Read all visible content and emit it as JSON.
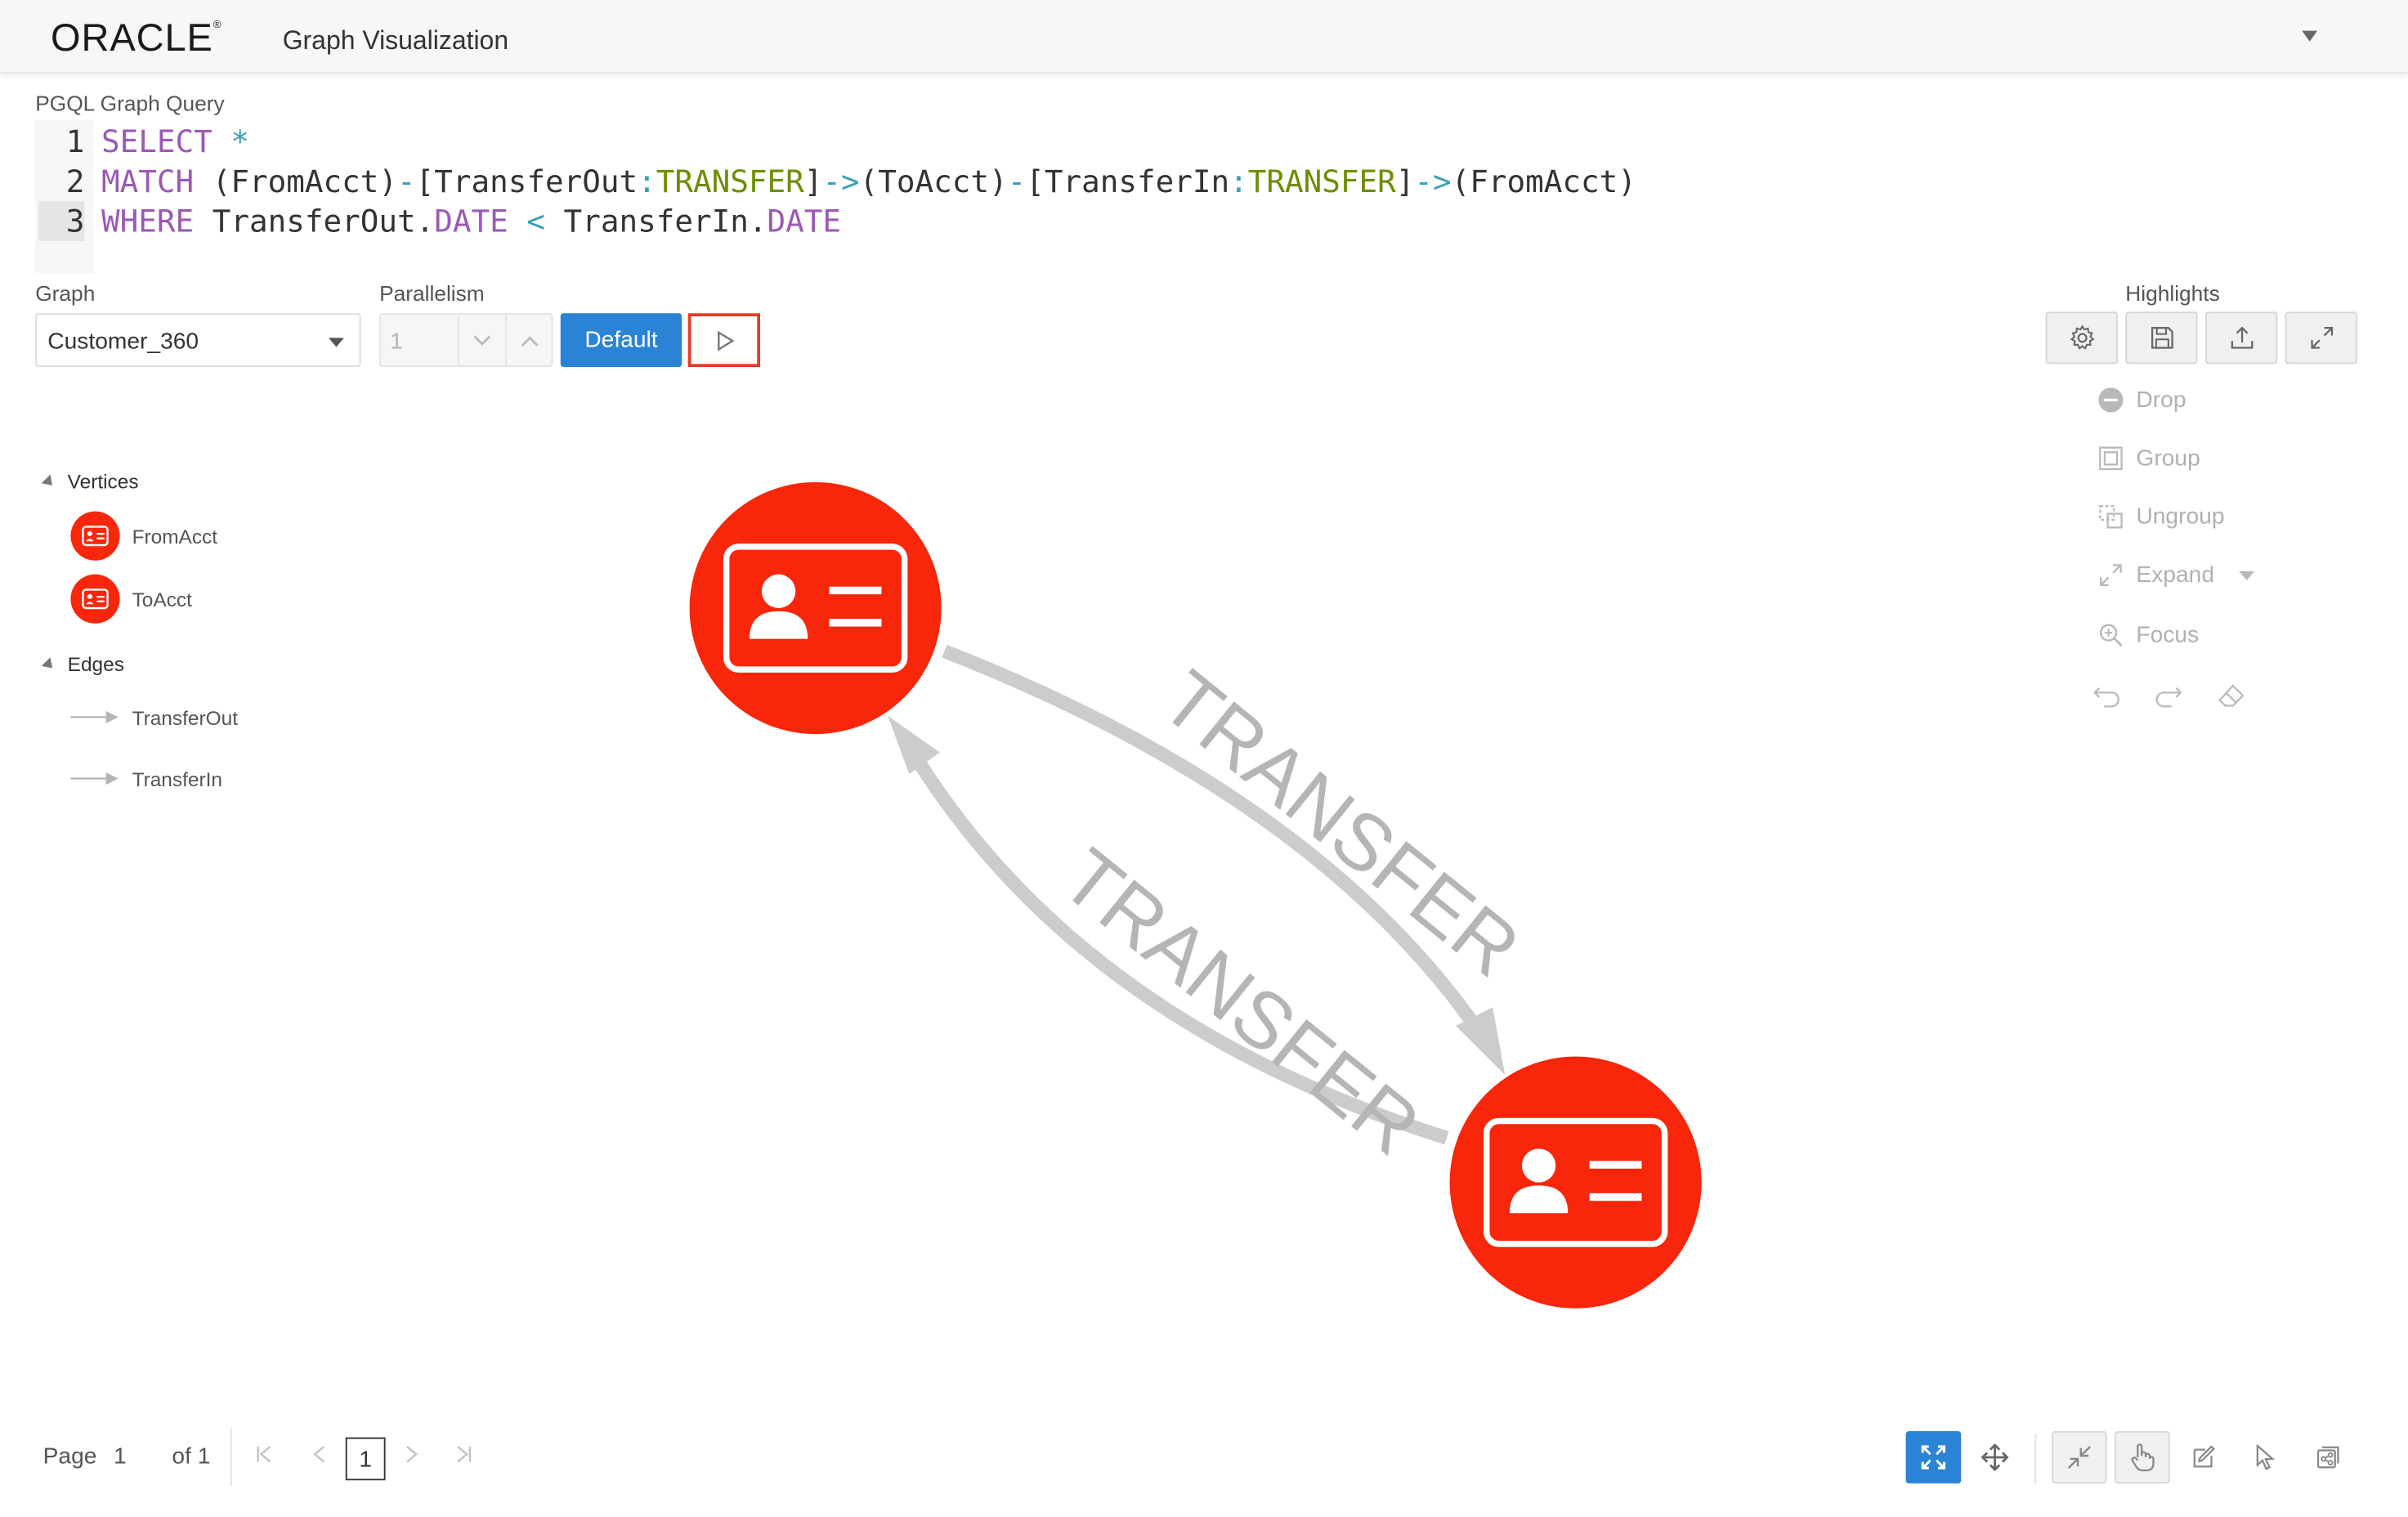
{
  "header": {
    "logo": "ORACLE",
    "app_title": "Graph Visualization"
  },
  "query": {
    "label": "PGQL Graph Query",
    "lines": [
      {
        "num": "1"
      },
      {
        "num": "2"
      },
      {
        "num": "3"
      }
    ],
    "line1": {
      "kw": "SELECT",
      "op": "*"
    },
    "line2": {
      "kw": "MATCH",
      "p1": "(FromAcct)",
      "d1": "-",
      "b1": "[TransferOut",
      "c1": ":",
      "l1": "TRANSFER",
      "b2": "]",
      "a1": "->",
      "p2": "(ToAcct)",
      "d2": "-",
      "b3": "[TransferIn",
      "c2": ":",
      "l2": "TRANSFER",
      "b4": "]",
      "a2": "->",
      "p3": "(FromAcct)"
    },
    "line3": {
      "kw": "WHERE",
      "t1": "TransferOut",
      "dot1": ".",
      "f1": "DATE",
      "lt": "<",
      "t2": "TransferIn",
      "dot2": ".",
      "f2": "DATE"
    }
  },
  "controls": {
    "graph_label": "Graph",
    "graph_value": "Customer_360",
    "parallelism_label": "Parallelism",
    "parallelism_value": "1",
    "default_button": "Default"
  },
  "highlights": {
    "label": "Highlights",
    "buttons": [
      "gear-icon",
      "save-icon",
      "upload-icon",
      "expand-icon"
    ]
  },
  "tools": [
    {
      "label": "Drop",
      "icon": "minus-circle-icon"
    },
    {
      "label": "Group",
      "icon": "group-icon"
    },
    {
      "label": "Ungroup",
      "icon": "ungroup-icon"
    },
    {
      "label": "Expand",
      "icon": "expand-arrows-icon"
    },
    {
      "label": "Focus",
      "icon": "zoom-icon"
    }
  ],
  "legend": {
    "vertices_label": "Vertices",
    "vertices": [
      "FromAcct",
      "ToAcct"
    ],
    "edges_label": "Edges",
    "edges": [
      "TransferOut",
      "TransferIn"
    ]
  },
  "graph": {
    "node_color": "#f8260a",
    "edge_color": "#cccccc",
    "edge_labels": [
      "TRANSFER",
      "TRANSFER"
    ]
  },
  "pager": {
    "page_label": "Page",
    "page_value": "1",
    "of_label": "of 1",
    "current": "1"
  },
  "colors": {
    "accent": "#2a83d5",
    "run_highlight": "#e8392a"
  }
}
